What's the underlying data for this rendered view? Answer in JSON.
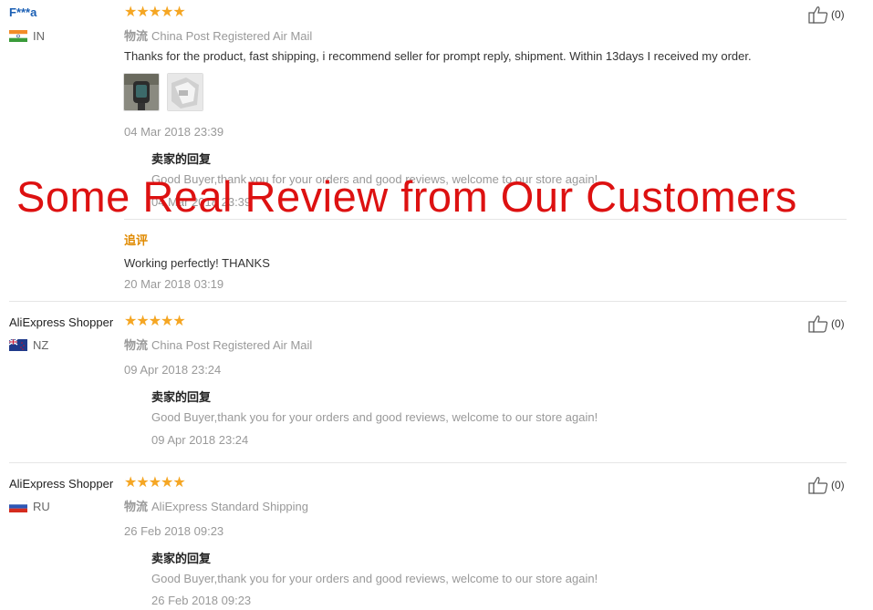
{
  "like_count_label": "(0)",
  "reviews": [
    {
      "user": "F***a",
      "country": "IN",
      "rating": 5,
      "stars": "★★★★★",
      "shipping_label": "物流",
      "shipping": "China Post Registered Air Mail",
      "text": "Thanks for the product, fast shipping, i recommend seller for prompt reply, shipment. Within 13days I received my order.",
      "date": "04 Mar 2018 23:39",
      "reply_heading": "卖家的回复",
      "reply_text": "Good Buyer,thank you for your orders and good reviews, welcome to our store again!",
      "reply_date": "04 Mar 2018 23:39",
      "followup_heading": "追评",
      "followup_text": "Working perfectly! THANKS",
      "followup_date": "20 Mar 2018 03:19"
    },
    {
      "user": "AliExpress Shopper",
      "country": "NZ",
      "rating": 5,
      "stars": "★★★★★",
      "shipping_label": "物流",
      "shipping": "China Post Registered Air Mail",
      "date": "09 Apr 2018 23:24",
      "reply_heading": "卖家的回复",
      "reply_text": "Good Buyer,thank you for your orders and good reviews, welcome to our store again!",
      "reply_date": "09 Apr 2018 23:24"
    },
    {
      "user": "AliExpress Shopper",
      "country": "RU",
      "rating": 5,
      "stars": "★★★★★",
      "shipping_label": "物流",
      "shipping": "AliExpress Standard Shipping",
      "date": "26 Feb 2018 09:23",
      "reply_heading": "卖家的回复",
      "reply_text": "Good Buyer,thank you for your orders and good reviews, welcome to our store again!",
      "reply_date": "26 Feb 2018 09:23"
    }
  ],
  "overlay_text": "Some Real Review from Our Customers",
  "colors": {
    "star": "#f5a623",
    "overlay": "#dd1111",
    "followup": "#e08a00",
    "link": "#1a5fb4"
  }
}
